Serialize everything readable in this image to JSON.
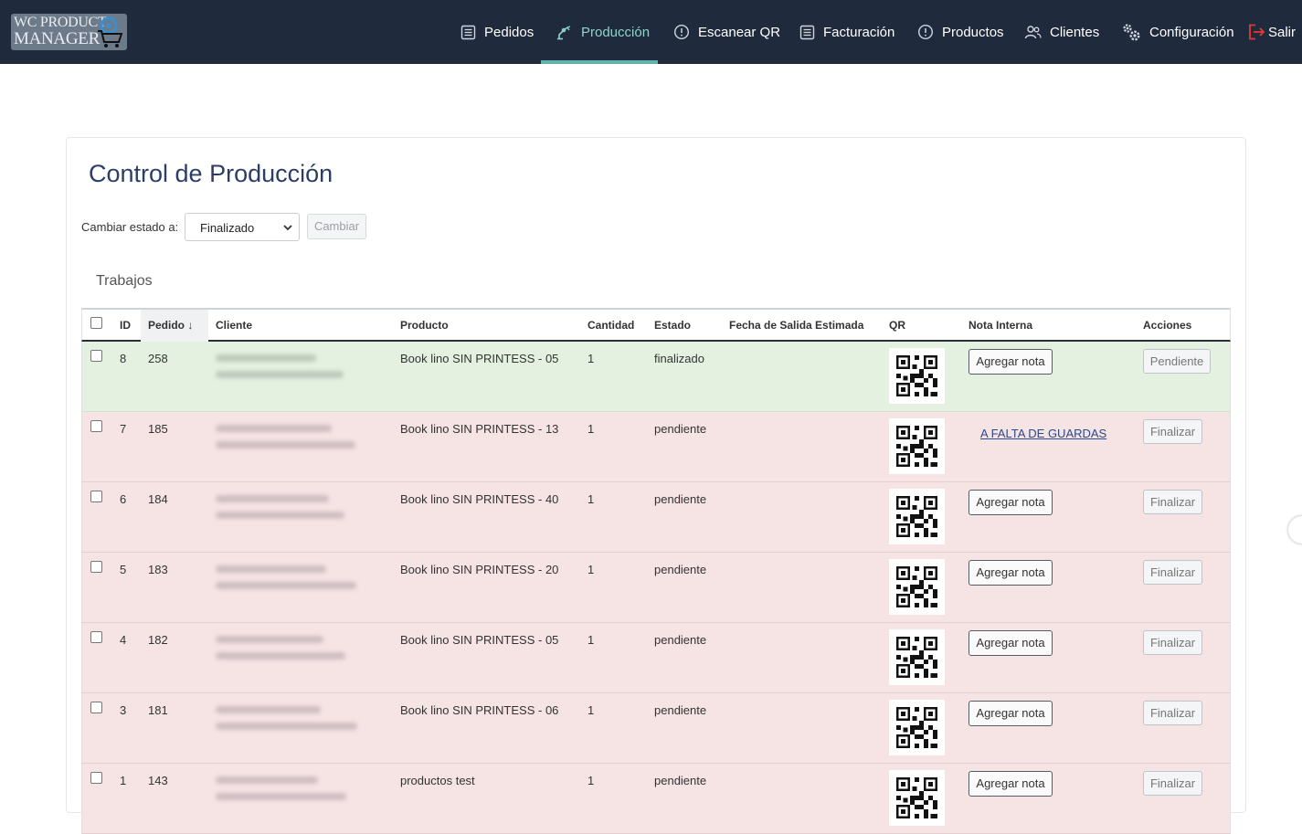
{
  "brand": {
    "logo_line1": "WC PRODUCT",
    "logo_line2": "MANAGER"
  },
  "nav": [
    {
      "label": "Pedidos",
      "icon": "list-icon",
      "active": false
    },
    {
      "label": "Producción",
      "icon": "robot-arm-icon",
      "active": true
    },
    {
      "label": "Escanear QR",
      "icon": "alert-circle-icon",
      "active": false
    },
    {
      "label": "Facturación",
      "icon": "list-icon",
      "active": false
    },
    {
      "label": "Productos",
      "icon": "alert-circle-icon",
      "active": false
    },
    {
      "label": "Clientes",
      "icon": "users-icon",
      "active": false
    },
    {
      "label": "Configuración",
      "icon": "gears-icon",
      "active": false
    },
    {
      "label": "Salir",
      "icon": "logout-icon",
      "active": false
    }
  ],
  "colors": {
    "topbar": "#1f2a3d",
    "active_nav": "#8ed3cc",
    "row_done": "#e4f1e1",
    "row_pending": "#f6e3e4",
    "title": "#2c3e66",
    "logout": "#e53935"
  },
  "page": {
    "title": "Control de Producción",
    "change_label": "Cambiar estado a:",
    "status_selected": "Finalizado",
    "change_button": "Cambiar",
    "section_title": "Trabajos"
  },
  "table": {
    "headers": {
      "id": "ID",
      "pedido": "Pedido ↓",
      "cliente": "Cliente",
      "producto": "Producto",
      "cantidad": "Cantidad",
      "estado": "Estado",
      "fecha": "Fecha de Salida Estimada",
      "qr": "QR",
      "nota": "Nota Interna",
      "acciones": "Acciones"
    },
    "rows": [
      {
        "id": "8",
        "pedido": "258",
        "producto": "Book lino SIN PRINTESS - 05",
        "cantidad": "1",
        "estado": "finalizado",
        "nota": "Agregar nota",
        "nota_is_link": false,
        "accion": "Pendiente",
        "done": true
      },
      {
        "id": "7",
        "pedido": "185",
        "producto": "Book lino SIN PRINTESS - 13",
        "cantidad": "1",
        "estado": "pendiente",
        "nota": "A FALTA DE GUARDAS",
        "nota_is_link": true,
        "accion": "Finalizar",
        "done": false
      },
      {
        "id": "6",
        "pedido": "184",
        "producto": "Book lino SIN PRINTESS - 40",
        "cantidad": "1",
        "estado": "pendiente",
        "nota": "Agregar nota",
        "nota_is_link": false,
        "accion": "Finalizar",
        "done": false
      },
      {
        "id": "5",
        "pedido": "183",
        "producto": "Book lino SIN PRINTESS - 20",
        "cantidad": "1",
        "estado": "pendiente",
        "nota": "Agregar nota",
        "nota_is_link": false,
        "accion": "Finalizar",
        "done": false
      },
      {
        "id": "4",
        "pedido": "182",
        "producto": "Book lino SIN PRINTESS - 05",
        "cantidad": "1",
        "estado": "pendiente",
        "nota": "Agregar nota",
        "nota_is_link": false,
        "accion": "Finalizar",
        "done": false
      },
      {
        "id": "3",
        "pedido": "181",
        "producto": "Book lino SIN PRINTESS - 06",
        "cantidad": "1",
        "estado": "pendiente",
        "nota": "Agregar nota",
        "nota_is_link": false,
        "accion": "Finalizar",
        "done": false
      },
      {
        "id": "1",
        "pedido": "143",
        "producto": "productos test",
        "cantidad": "1",
        "estado": "pendiente",
        "nota": "Agregar nota",
        "nota_is_link": false,
        "accion": "Finalizar",
        "done": false
      }
    ]
  }
}
